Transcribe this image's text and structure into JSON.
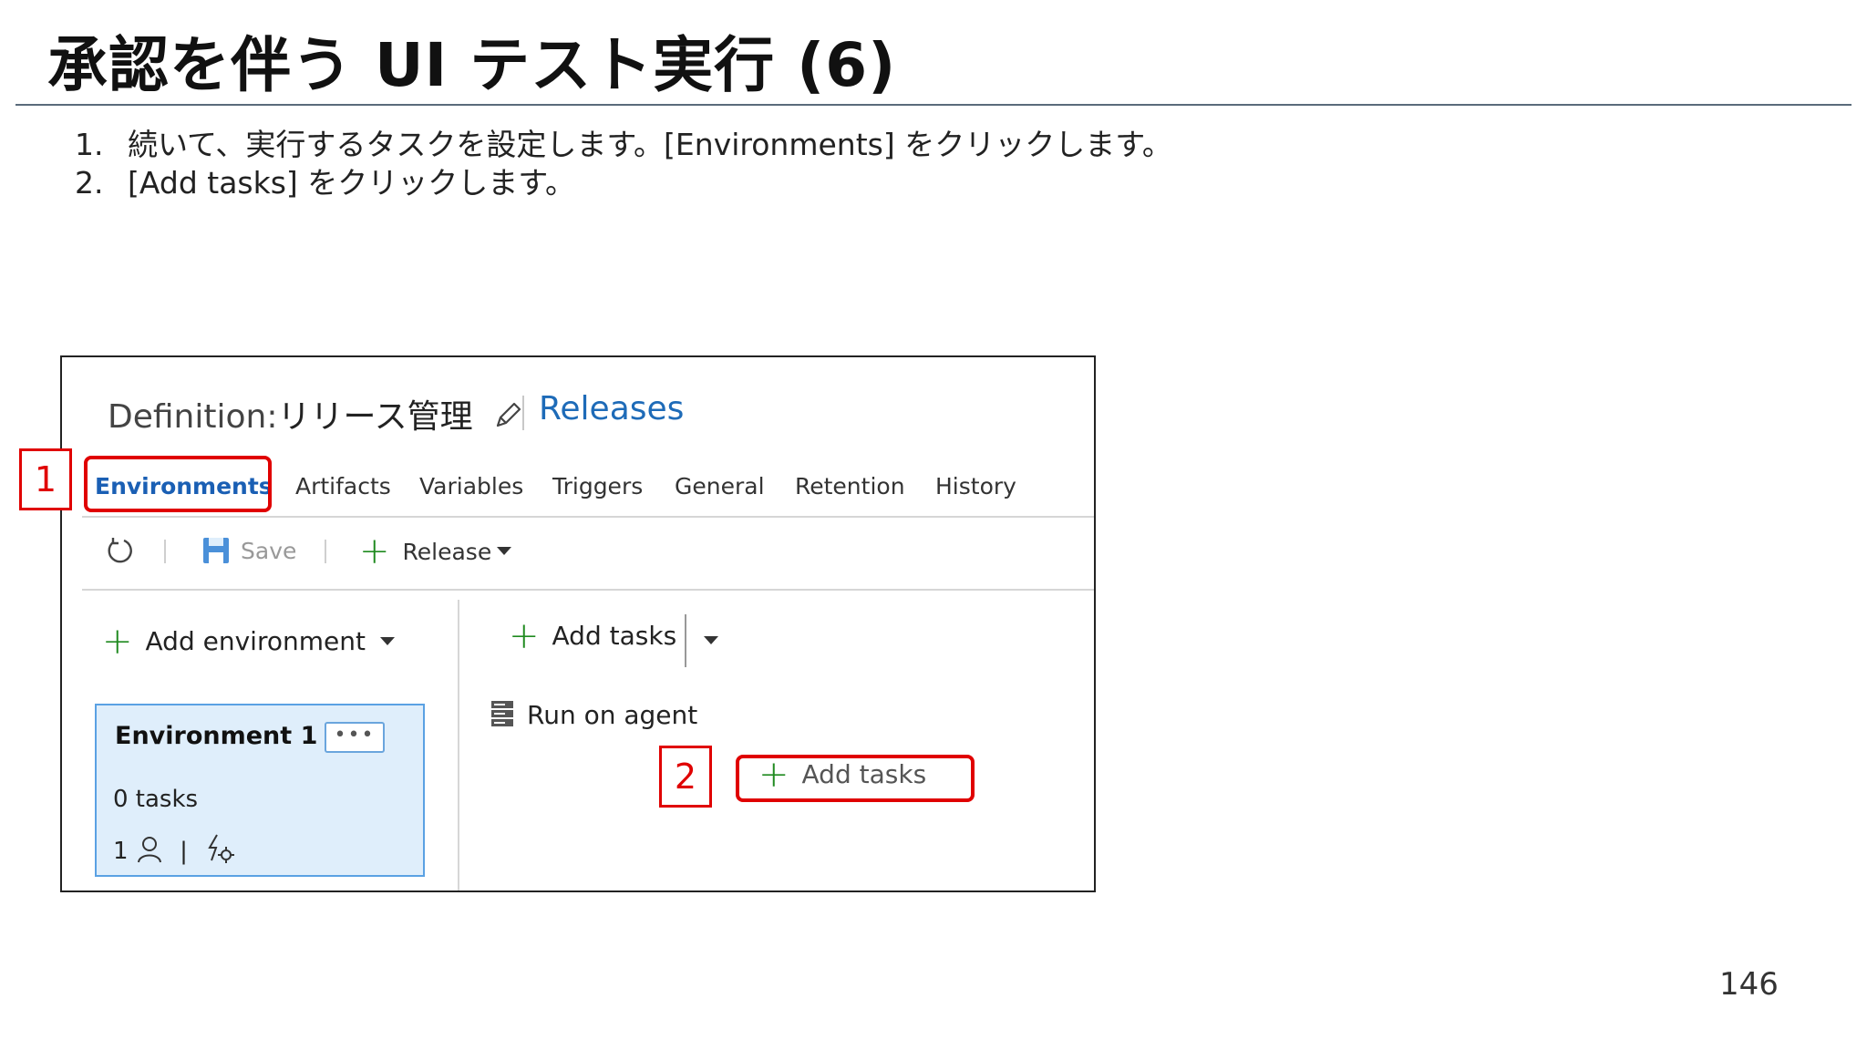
{
  "slide": {
    "title": "承認を伴う UI テスト実行 (6)",
    "page_number": "146"
  },
  "steps": [
    {
      "num": "1.",
      "text": "続いて、実行するタスクを設定します。[Environments] をクリックします。"
    },
    {
      "num": "2.",
      "text": "[Add tasks] をクリックします。"
    }
  ],
  "screenshot": {
    "definition_label": "Definition:",
    "definition_name": "リリース管理",
    "releases_link": "Releases",
    "tabs": [
      "Environments",
      "Artifacts",
      "Variables",
      "Triggers",
      "General",
      "Retention",
      "History"
    ],
    "active_tab": "Environments",
    "toolbar": {
      "save": "Save",
      "release": "Release"
    },
    "add_environment": "Add environment",
    "environment": {
      "name": "Environment 1",
      "more": "•••",
      "tasks": "0 tasks",
      "approvers": "1",
      "divider": "|"
    },
    "add_tasks": "Add tasks",
    "run_on_agent": "Run on agent",
    "add_tasks_button": "Add tasks"
  },
  "callouts": {
    "one": "1",
    "two": "2"
  },
  "colors": {
    "highlight": "#e00000",
    "link": "#1e6bb8",
    "plus": "#1f8a1f",
    "card_bg": "#dfeefb"
  }
}
